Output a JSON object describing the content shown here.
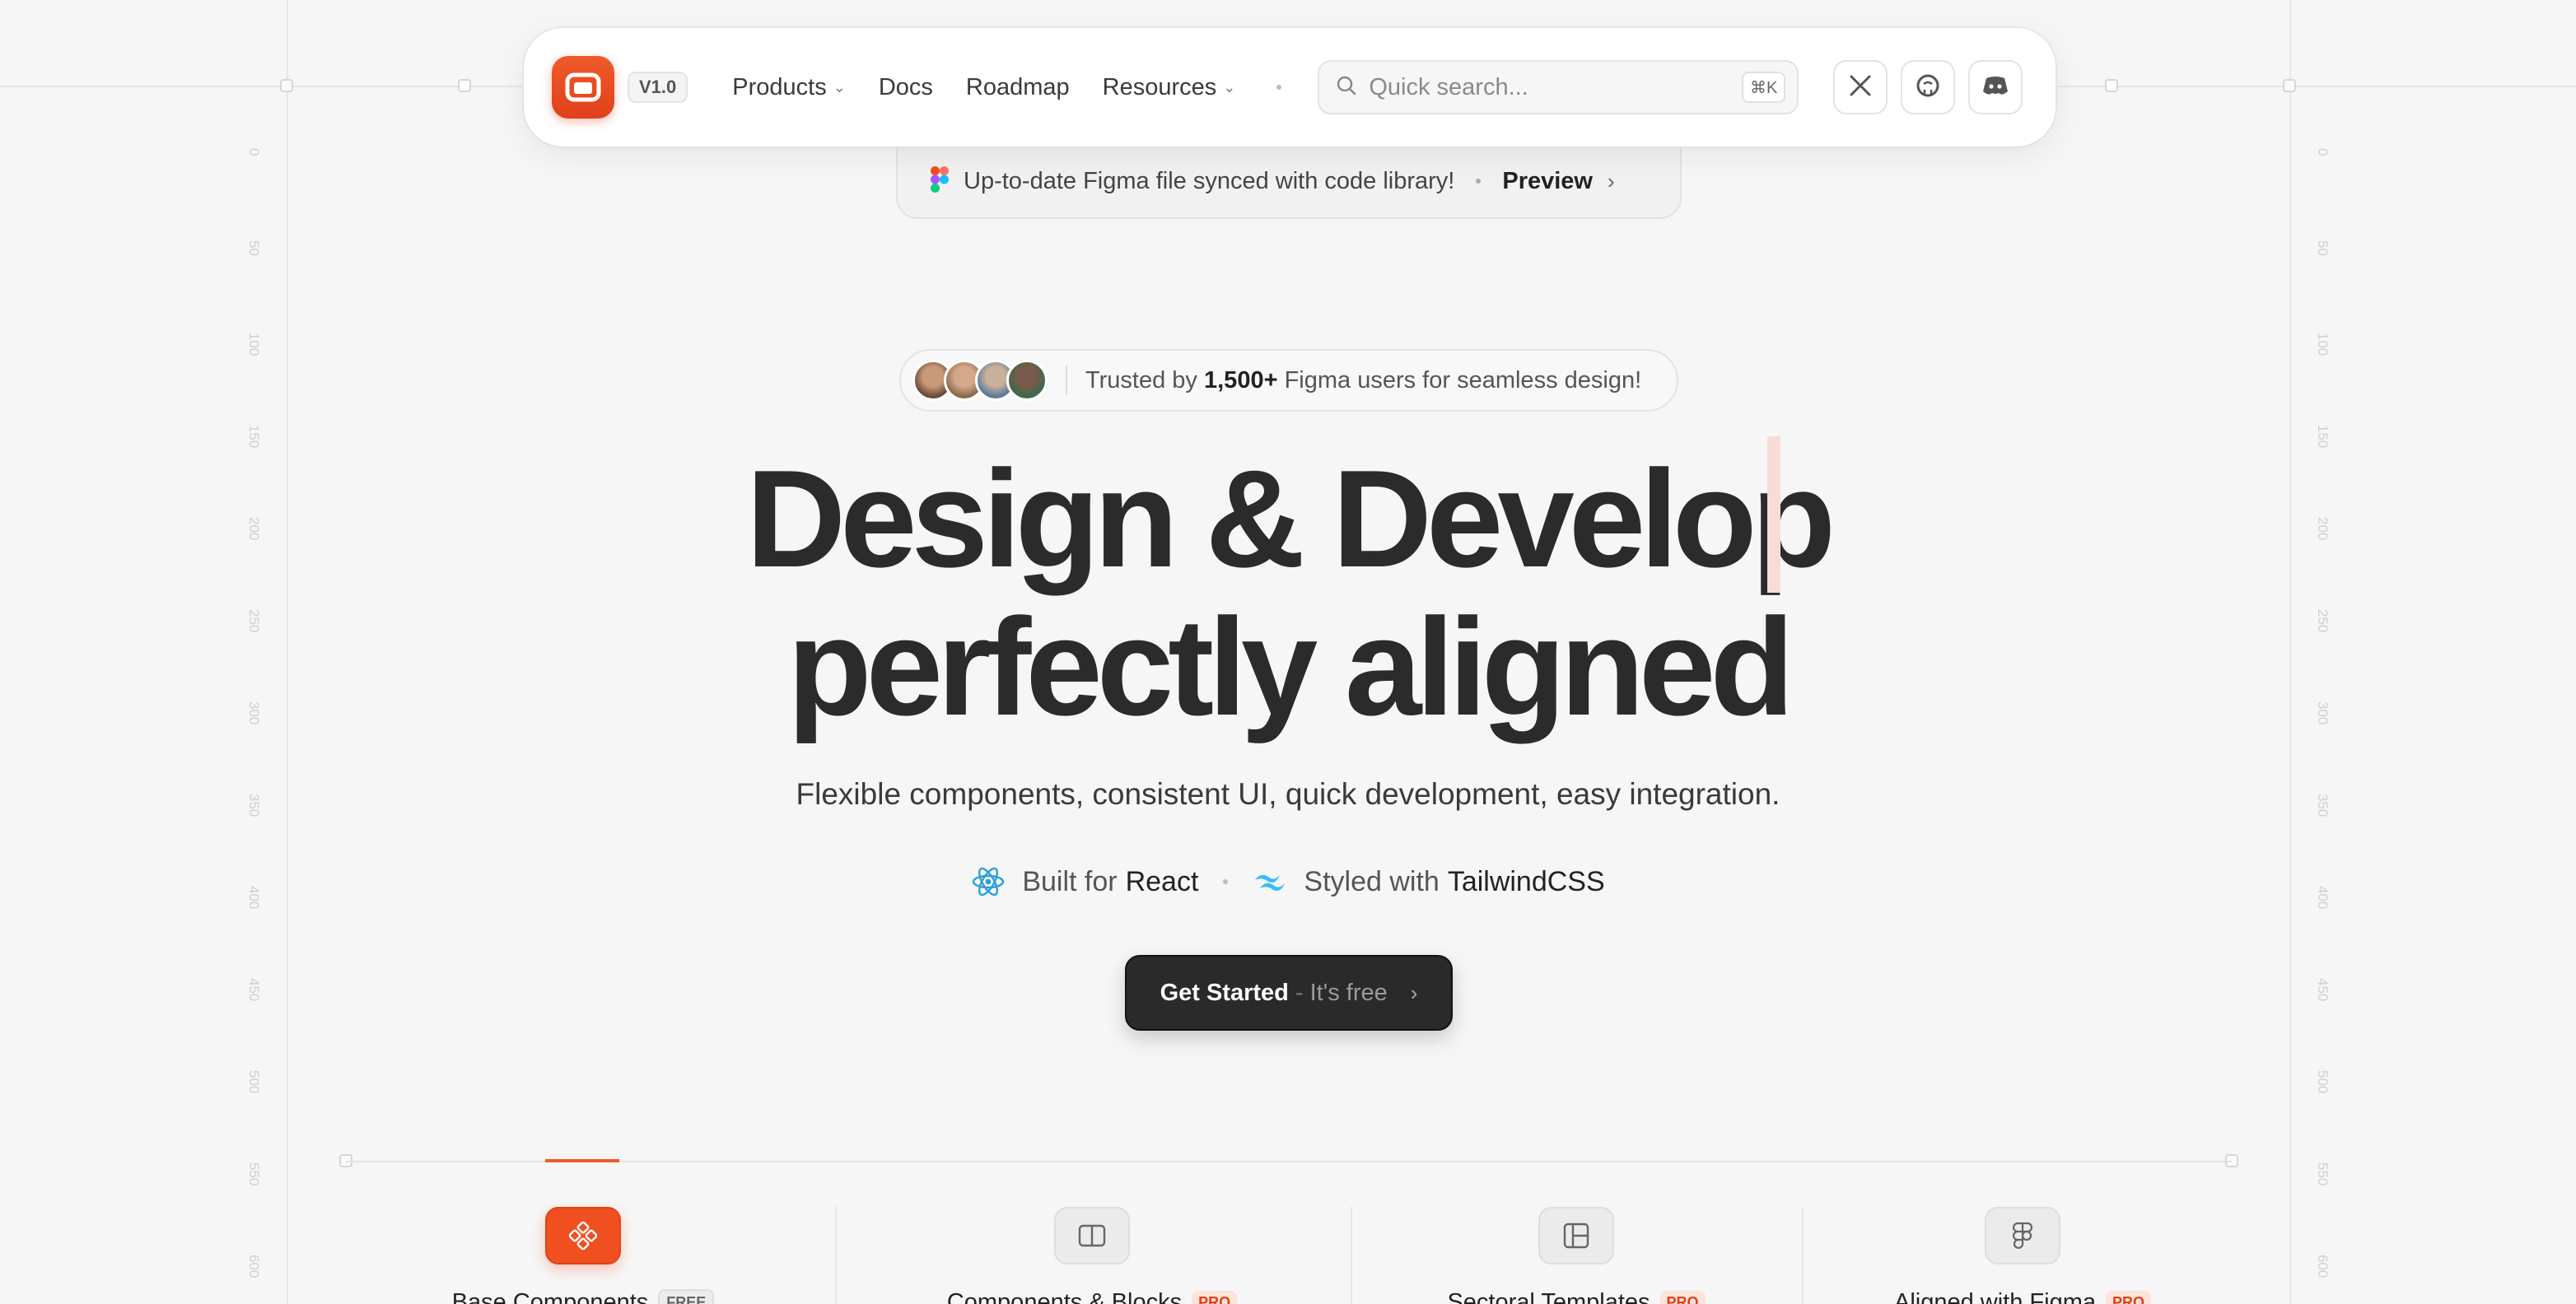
{
  "nav": {
    "version": "V1.0",
    "links": [
      "Products",
      "Docs",
      "Roadmap",
      "Resources"
    ],
    "search_placeholder": "Quick search...",
    "search_shortcut": "⌘K",
    "social": [
      "x-icon",
      "github-icon",
      "discord-icon"
    ]
  },
  "banner": {
    "text": "Up-to-date Figma file synced with code library!",
    "link": "Preview"
  },
  "trusted": {
    "prefix": "Trusted by",
    "count": "1,500+",
    "suffix": "Figma users for seamless design!"
  },
  "hero": {
    "title_line1": "Design & Develop",
    "title_line2": "perfectly aligned",
    "subtitle": "Flexible components, consistent UI, quick development, easy integration."
  },
  "tech": {
    "react_prefix": "Built for",
    "react": "React",
    "tailwind_prefix": "Styled with",
    "tailwind": "TailwindCSS"
  },
  "cta": {
    "main": "Get Started",
    "dash": "-",
    "sub": "It's free"
  },
  "features": [
    {
      "label": "Base Components",
      "badge": "FREE"
    },
    {
      "label": "Components & Blocks",
      "badge": "PRO"
    },
    {
      "label": "Sectoral Templates",
      "badge": "PRO"
    },
    {
      "label": "Aligned with Figma",
      "badge": "PRO"
    }
  ],
  "ruler_ticks": [
    "0",
    "50",
    "100",
    "150",
    "200",
    "250",
    "300",
    "350",
    "400",
    "450",
    "500",
    "550",
    "600"
  ],
  "colors": {
    "accent": "#f05a2a",
    "background": "#f6f6f6",
    "cta": "#2a2a2a"
  }
}
